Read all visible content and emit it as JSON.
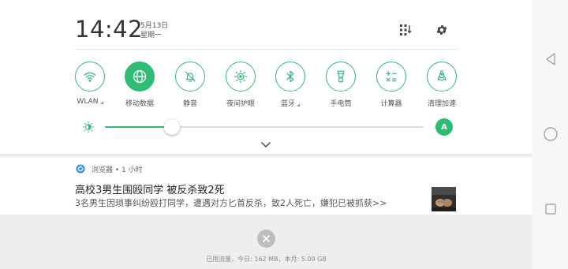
{
  "status": {
    "time": "14:42",
    "date": "5月13日",
    "weekday": "星期一"
  },
  "header_buttons": [
    {
      "icon": "tile-grid-icon"
    },
    {
      "icon": "gear-icon"
    }
  ],
  "tiles": [
    {
      "label": "WLAN",
      "icon": "wifi-icon",
      "active": false,
      "has_corner": true
    },
    {
      "label": "移动数据",
      "icon": "globe-icon",
      "active": true,
      "has_corner": false
    },
    {
      "label": "静音",
      "icon": "bell-mute-icon",
      "active": false,
      "has_corner": false
    },
    {
      "label": "夜间护眼",
      "icon": "sun-eye-icon",
      "active": false,
      "has_corner": false
    },
    {
      "label": "蓝牙",
      "icon": "bluetooth-icon",
      "active": false,
      "has_corner": true
    },
    {
      "label": "手电筒",
      "icon": "flashlight-icon",
      "active": false,
      "has_corner": false
    },
    {
      "label": "计算器",
      "icon": "calculator-icon",
      "active": false,
      "has_corner": false
    },
    {
      "label": "清理加速",
      "icon": "rocket-icon",
      "active": false,
      "has_corner": false
    }
  ],
  "brightness": {
    "level": 0.21,
    "auto_label": "A"
  },
  "notification": {
    "app": "浏览器",
    "time_ago": "1 小时",
    "separator": "•",
    "title": "高校3男生围殴同学 被反杀致2死",
    "body": "3名男生因琐事纠纷殴打同学，遭遇对方匕首反杀，致2人死亡，嫌犯已被抓获>>"
  },
  "footer": {
    "usage_text": "已用流量，今日: 162 MB，本月: 5.09 GB"
  },
  "colors": {
    "accent": "#2fbd76",
    "panel_bg": "#ffffff",
    "footer_bg": "#eeeeee",
    "navbar_bg": "#f7f7f7"
  }
}
